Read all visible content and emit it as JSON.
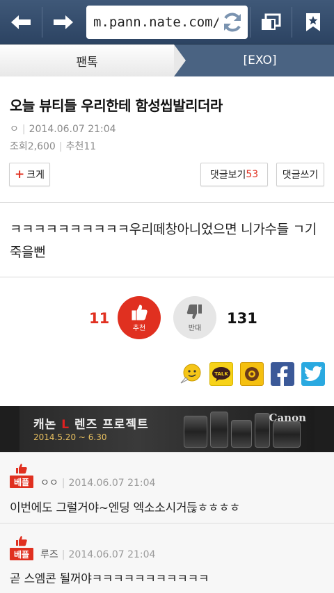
{
  "browser": {
    "url": "m.pann.nate.com/t",
    "icons": [
      "back-arrow-icon",
      "forward-arrow-icon",
      "refresh-icon",
      "tabs-icon",
      "bookmark-icon"
    ]
  },
  "breadcrumb": {
    "section": "팬톡",
    "board": "[EXO]"
  },
  "article": {
    "title": "오늘 뷰티들 우리한테 함성씹발리더라",
    "author": "ㅇ",
    "date": "2014.06.07 21:04",
    "views": "조회2,600",
    "recommend_meta": "추천11",
    "enlarge_label": "크게",
    "view_comments_label": "댓글보기",
    "comment_count": "53",
    "write_comment_label": "댓글쓰기",
    "body": "ㅋㅋㅋㅋㅋㅋㅋㅋㅋㅋ우리떼창아니었으면 니가수들 ㄱ기죽을뻔"
  },
  "vote": {
    "up_count": "11",
    "up_label": "추천",
    "down_label": "반대",
    "down_count": "131",
    "colors": {
      "up": "#e03020",
      "down": "#e6e6e6"
    }
  },
  "share": {
    "icons": [
      "emoticon-icon",
      "kakaotalk-icon",
      "kakaostory-icon",
      "facebook-icon",
      "twitter-icon"
    ],
    "talk_label": "TALK"
  },
  "banner": {
    "title_prefix": "캐논 ",
    "title_L": "L",
    "title_suffix": " 렌즈 프로젝트",
    "date": "2014.5.20 ~ 6.30",
    "logo": "Canon"
  },
  "comments": [
    {
      "badge": "베플",
      "author": "ㅇㅇ",
      "date": "2014.06.07 21:04",
      "text": "이번에도 그럴거야~엔딩 엑소소시거듢ㅎㅎㅎㅎ"
    },
    {
      "badge": "베플",
      "author": "루즈",
      "date": "2014.06.07 21:04",
      "text": "곧 스엠콘 될꺼야ㅋㅋㅋㅋㅋㅋㅋㅋㅋㅋㅋ"
    }
  ]
}
